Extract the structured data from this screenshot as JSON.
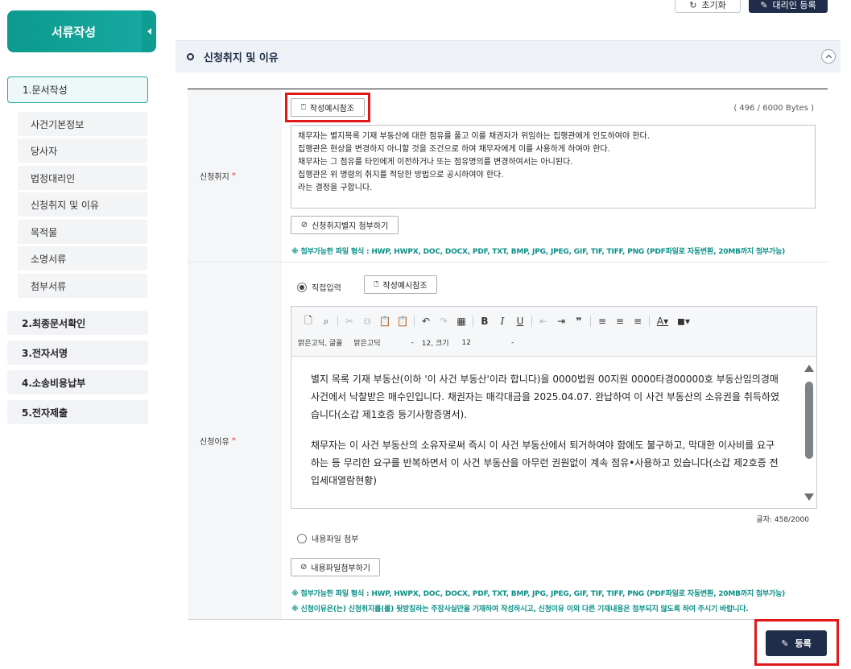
{
  "top_buttons": {
    "reset_label": "초기화",
    "proxy_register_label": "대리인 등록"
  },
  "sidebar": {
    "title": "서류작성",
    "items": [
      {
        "label": "1.문서작성"
      },
      {
        "label": "2.최종문서확인"
      },
      {
        "label": "3.전자서명"
      },
      {
        "label": "4.소송비용납부"
      },
      {
        "label": "5.전자제출"
      }
    ],
    "sub_items": [
      {
        "label": "사건기본정보"
      },
      {
        "label": "당사자"
      },
      {
        "label": "법정대리인"
      },
      {
        "label": "신청취지 및 이유"
      },
      {
        "label": "목적물"
      },
      {
        "label": "소명서류"
      },
      {
        "label": "첨부서류"
      }
    ]
  },
  "section": {
    "title": "신청취지 및 이유"
  },
  "purpose": {
    "label": "신청취지",
    "required_mark": "*",
    "example_button": "작성예시참조",
    "byte_count": "( 496 / 6000 Bytes )",
    "lines": [
      "채무자는 별지목록 기재 부동산에 대한 점유를 풀고 이를 채권자가 위임하는 집행관에게 인도하여야 한다.",
      "집행관은 현상을 변경하지 아니할 것을 조건으로 하여 채무자에게 이를 사용하게 하여야 한다.",
      "채무자는 그 점유를 타인에게 이전하거나 또는 점유명의를 변경하여서는 아니된다.",
      "집행관은 위 명령의 취지를 적당한 방법으로 공시하여야 한다.",
      "라는 결정을 구합니다."
    ],
    "attach_button": "신청취지별지 첨부하기",
    "notice": "※ 첨부가능한 파일 형식 : HWP, HWPX, DOC, DOCX, PDF, TXT, BMP, JPG, JPEG, GIF, TIF, TIFF, PNG (PDF파일로 자동변환, 20MB까지 첨부가능)"
  },
  "reason": {
    "label": "신청이유",
    "required_mark": "*",
    "radio_direct": "직접입력",
    "example_button": "작성예시참조",
    "toolbar": {
      "font_label": "맑은고딕, 글꼴",
      "font_value": "맑은고딕",
      "size_label": "12, 크기",
      "size_value": "12",
      "caret": "-"
    },
    "paragraph1": "별지 목록 기재 부동산(이하 '이 사건 부동산'이라 합니다)을 0000법원 00지원 0000타경00000호 부동산임의경매사건에서 낙찰받은 매수인입니다. 채권자는 매각대금을 2025.04.07. 완납하여 이 사건 부동산의 소유권을 취득하였습니다(소갑 제1호증 등기사항증명서).",
    "paragraph2": "채무자는 이 사건 부동산의 소유자로써 즉시 이 사건 부동산에서 퇴거하여야 함에도 불구하고, 막대한 이사비를 요구하는 등 무리한 요구를 반복하면서 이 사건 부동산을 아무런 권원없이 계속 점유•사용하고 있습니다(소갑 제2호증 전입세대열람현황)",
    "char_count": "글자: 458/2000",
    "radio_file": "내용파일 첨부",
    "attach_button": "내용파일첨부하기",
    "notice1": "※ 첨부가능한 파일 형식 : HWP, HWPX, DOC, DOCX, PDF, TXT, BMP, JPG, JPEG, GIF, TIF, TIFF, PNG (PDF파일로 자동변환, 20MB까지 첨부가능)",
    "notice2": "※ 신청이유은(는) 신청취지를(를) 뒷받침하는 주장사실만을 기재하여 작성하시고, 신청이유 이외 다른 기재내용은 첨부되지 않도록 하여 주시기 바랍니다."
  },
  "submit_label": "등록",
  "colors": {
    "accent_teal": "#16a9a0",
    "navy": "#1f2d4a",
    "highlight_red": "#e0191b",
    "notice_teal": "#0a8f86"
  }
}
